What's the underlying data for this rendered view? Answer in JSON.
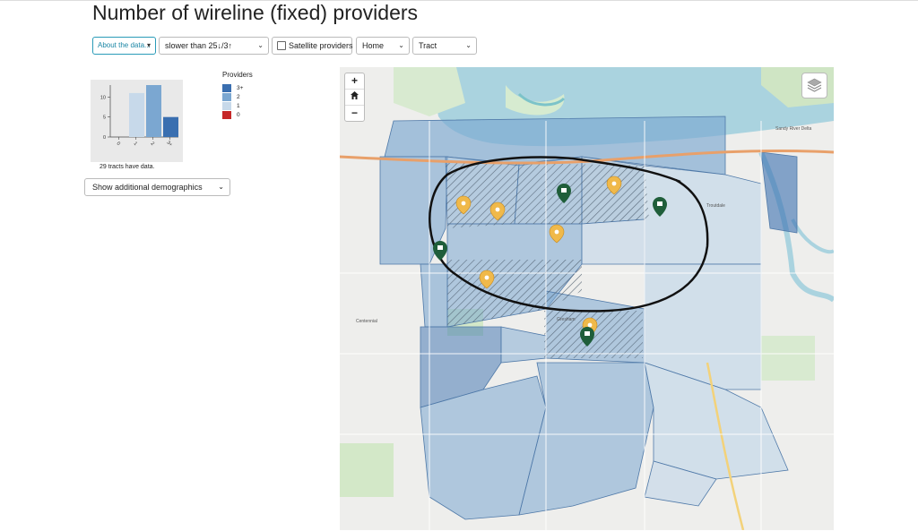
{
  "page": {
    "title": "Number of wireline (fixed) providers"
  },
  "toolbar": {
    "about_label": "About the data...",
    "speed_value": "slower than 25↓/3↑",
    "satellite_label": "Satellite providers",
    "satellite_checked": false,
    "location_value": "Home",
    "geography_value": "Tract"
  },
  "histogram": {
    "chart_data": {
      "type": "bar",
      "categories": [
        "0",
        "1",
        "2",
        "3+"
      ],
      "values": [
        0,
        11,
        13,
        5
      ],
      "ylim": [
        0,
        13
      ],
      "yticks": [
        "0",
        "5",
        "10"
      ],
      "colors": [
        "#c62828",
        "#c7d9ea",
        "#7ba7d1",
        "#3a6fb0"
      ]
    },
    "note": "29 tracts have data."
  },
  "demographics_select": "Show additional demographics",
  "legend": {
    "title": "Providers",
    "items": [
      {
        "label": "3+",
        "color": "#3a6fb0"
      },
      {
        "label": "2",
        "color": "#7ba7d1"
      },
      {
        "label": "1",
        "color": "#c7d9ea"
      },
      {
        "label": "0",
        "color": "#c62828"
      }
    ]
  },
  "map": {
    "zoom_in": "+",
    "zoom_out": "−",
    "place_labels": [
      "Sandy River Delta",
      "Troutdale",
      "Gresham",
      "Centennial"
    ]
  }
}
